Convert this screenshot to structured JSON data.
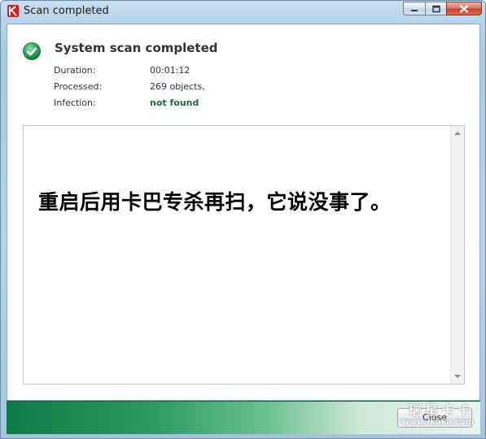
{
  "window": {
    "title": "Scan completed",
    "icon": "kaspersky-k-icon",
    "controls": [
      "minimize-icon",
      "maximize-icon",
      "close-icon"
    ]
  },
  "report": {
    "status_icon": "green-checkmark-icon",
    "headline": "System scan completed",
    "stats": [
      {
        "label": "Duration:",
        "value": "00:01:12"
      },
      {
        "label": "Processed:",
        "value": "269 objects,"
      },
      {
        "label": "Infection:",
        "value": "not found"
      }
    ],
    "infection_color": "#1f6b3a"
  },
  "log": {
    "text": "重启后用卡巴专杀再扫，它说没事了。"
  },
  "footer": {
    "close_label": "Close"
  },
  "watermark": {
    "cn": "瑞星卡卡",
    "url": "www.ikaka.com"
  }
}
